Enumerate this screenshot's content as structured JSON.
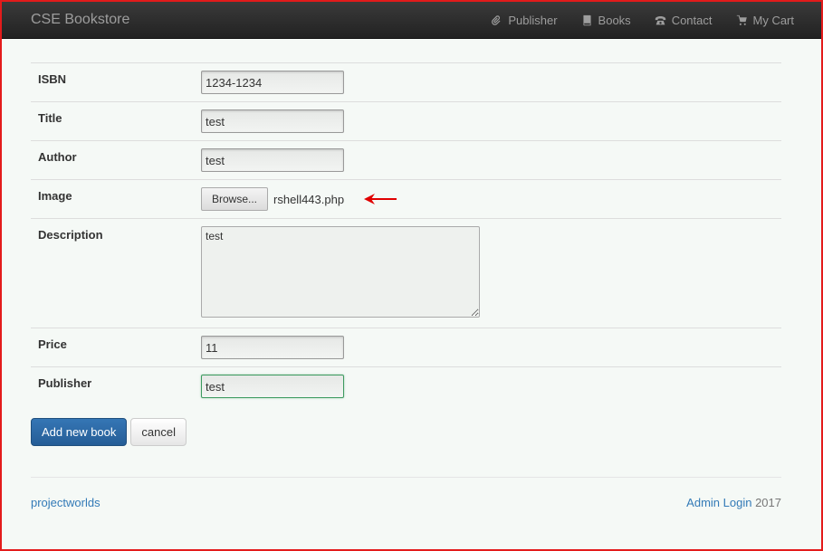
{
  "navbar": {
    "brand": "CSE Bookstore",
    "items": [
      {
        "label": "Publisher",
        "icon": "paperclip-icon"
      },
      {
        "label": "Books",
        "icon": "book-icon"
      },
      {
        "label": "Contact",
        "icon": "phone-icon"
      },
      {
        "label": "My Cart",
        "icon": "cart-icon"
      }
    ]
  },
  "form": {
    "isbn": {
      "label": "ISBN",
      "value": "1234-1234"
    },
    "title": {
      "label": "Title",
      "value": "test"
    },
    "author": {
      "label": "Author",
      "value": "test"
    },
    "image": {
      "label": "Image",
      "button": "Browse...",
      "filename": "rshell443.php"
    },
    "description": {
      "label": "Description",
      "value": "test"
    },
    "price": {
      "label": "Price",
      "value": "11"
    },
    "publisher": {
      "label": "Publisher",
      "value": "test"
    }
  },
  "actions": {
    "submit": "Add new book",
    "cancel": "cancel"
  },
  "footer": {
    "left_link": "projectworlds",
    "right_link": "Admin Login",
    "year": "2017"
  },
  "colors": {
    "frame_border": "#e31b1b",
    "annotation_arrow": "#e00000",
    "primary": "#2a6aa8",
    "link": "#337ab7"
  }
}
